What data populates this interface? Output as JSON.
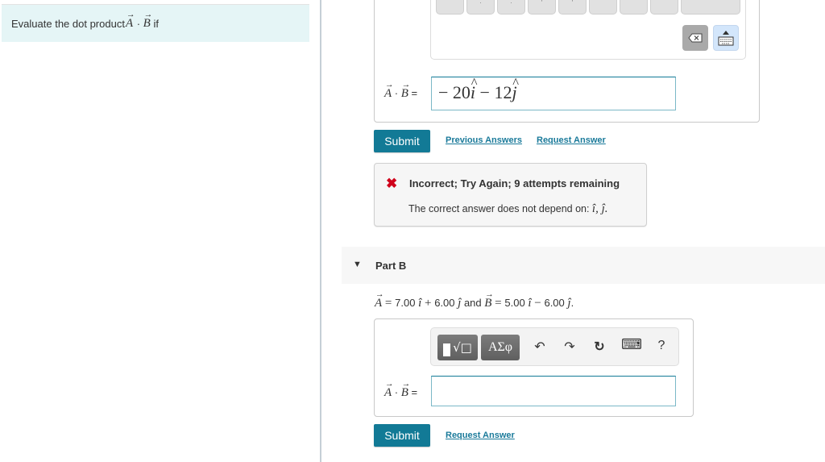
{
  "prompt": {
    "text_before": "Evaluate the dot product ",
    "var_a": "A",
    "dot": " · ",
    "var_b": "B",
    "text_after": " if"
  },
  "part_a": {
    "label_a": "A",
    "label_dot": " · ",
    "label_b": "B",
    "label_eq": " =",
    "answer_value": {
      "minus1": "− 20",
      "i": "i",
      "minus2": " − 12",
      "j": "j"
    },
    "keyboard_buttons": {
      "backspace": "backspace",
      "collapse": "collapse-keyboard"
    },
    "submit_label": "Submit",
    "previous_answers_label": "Previous Answers",
    "request_answer_label": "Request Answer",
    "feedback": {
      "title": "Incorrect; Try Again; 9 attempts remaining",
      "message": "The correct answer does not depend on: ",
      "vars": "î, ĵ."
    }
  },
  "part_b": {
    "title": "Part B",
    "given": {
      "a_label": "A",
      "a_expr_1": " = ",
      "a_x": "7.00",
      "a_plus": " + ",
      "a_y": "6.00",
      "and": " and ",
      "b_label": "B",
      "b_eq": " = ",
      "b_x": "5.00",
      "b_minus": " − ",
      "b_y": "6.00",
      "i_hat": "î",
      "j_hat": "ĵ",
      "period": "."
    },
    "toolbar": {
      "templates_label": "√□",
      "greek_label": "ΑΣφ",
      "undo": "↶",
      "redo": "↷",
      "reset": "↻",
      "keyboard": "⌨",
      "help": "?"
    },
    "label_a": "A",
    "label_dot": " · ",
    "label_b": "B",
    "label_eq": " =",
    "answer_value": "",
    "submit_label": "Submit",
    "request_answer_label": "Request Answer"
  },
  "colors": {
    "accent": "#127a96",
    "link": "#1a7a9a",
    "error": "#d0021b",
    "prompt_bg": "#e5f5f6"
  }
}
